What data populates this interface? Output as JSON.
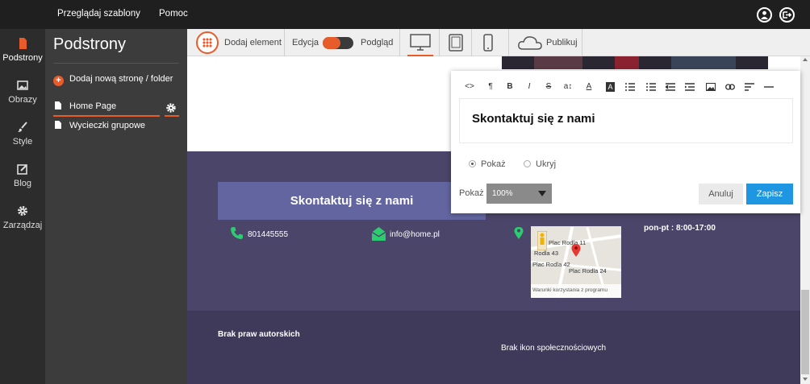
{
  "topbar": {
    "browse_templates": "Przeglądaj szablony",
    "help": "Pomoc",
    "icons": [
      "user-icon",
      "logout-icon"
    ]
  },
  "leftnav": {
    "items": [
      {
        "label": "Podstrony",
        "icon": "page-icon",
        "active": true
      },
      {
        "label": "Obrazy",
        "icon": "image-icon",
        "active": false
      },
      {
        "label": "Style",
        "icon": "brush-icon",
        "active": false
      },
      {
        "label": "Blog",
        "icon": "edit-icon",
        "active": false
      },
      {
        "label": "Zarządzaj",
        "icon": "gear-icon",
        "active": false
      }
    ]
  },
  "pages_panel": {
    "title": "Podstrony",
    "add_label": "Dodaj nową stronę / folder",
    "pages": [
      {
        "label": "Home Page",
        "selected": true
      },
      {
        "label": "Wycieczki grupowe",
        "selected": false
      }
    ]
  },
  "toolbar": {
    "add_element": "Dodaj element",
    "edit_mode": "Edycja",
    "preview_mode": "Podgląd",
    "devices": [
      "desktop-icon",
      "tablet-icon",
      "phone-icon"
    ],
    "active_device": "desktop",
    "publish": "Publikuj"
  },
  "site": {
    "contact_heading": "Skontaktuj się z nami",
    "phone": "801445555",
    "email": "info@home.pl",
    "hours": "pon-pt : 8:00-17:00",
    "map": {
      "labels": [
        "Plac Rodla 11",
        "Rodla 43",
        "Plac Rodla 42",
        "Plac Rodla 24"
      ],
      "terms": "Warunki korzystania z programu"
    },
    "copyright": "Brak praw autorskich",
    "social": "Brak ikon społecznościowych"
  },
  "editor": {
    "toolbar_buttons": [
      "<>",
      "¶",
      "B",
      "I",
      "S",
      "a↕",
      "A",
      "A",
      "list-ul",
      "list-ol",
      "outdent",
      "indent",
      "image",
      "link",
      "align",
      "hr"
    ],
    "content_heading": "Skontaktuj się z nami",
    "radio_show": "Pokaż",
    "radio_hide": "Ukryj",
    "radio_selected": "show",
    "opacity_label": "Pokaż",
    "opacity_value": "100%",
    "cancel": "Anuluj",
    "save": "Zapisz"
  },
  "colors": {
    "accent": "#e85c2b",
    "primary_button": "#1e96e1",
    "footer_bg": "#4b4569",
    "footer_bottom_bg": "#3f3a5a",
    "contact_box": "#6265a0"
  }
}
